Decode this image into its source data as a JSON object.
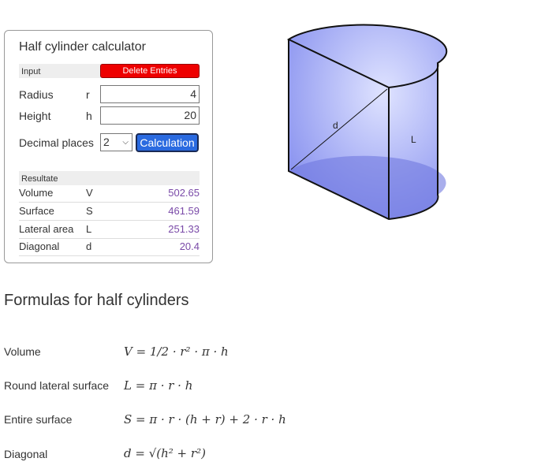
{
  "calculator": {
    "title": "Half cylinder calculator",
    "input_header": "Input",
    "delete_label": "Delete Entries",
    "inputs": [
      {
        "label": "Radius",
        "symbol": "r",
        "value": "4"
      },
      {
        "label": "Height",
        "symbol": "h",
        "value": "20"
      }
    ],
    "decimal_label": "Decimal places",
    "decimal_value": "2",
    "calc_label": "Calculation",
    "results_header": "Resultate",
    "results": [
      {
        "label": "Volume",
        "symbol": "V",
        "value": "502.65"
      },
      {
        "label": "Surface",
        "symbol": "S",
        "value": "461.59"
      },
      {
        "label": "Lateral area",
        "symbol": "L",
        "value": "251.33"
      },
      {
        "label": "Diagonal",
        "symbol": "d",
        "value": "20.4"
      }
    ]
  },
  "figure": {
    "diag_label": "d",
    "lateral_label": "L"
  },
  "formulas": {
    "title": "Formulas for half cylinders",
    "items": [
      {
        "label": "Volume",
        "formula": "V = 1/2 · r² · π · h"
      },
      {
        "label": "Round lateral surface",
        "formula": "L = π · r · h"
      },
      {
        "label": "Entire surface",
        "formula": "S = π · r · (h + r) + 2 · r · h"
      },
      {
        "label": "Diagonal",
        "formula": "d = √(h² + r²)"
      }
    ]
  }
}
